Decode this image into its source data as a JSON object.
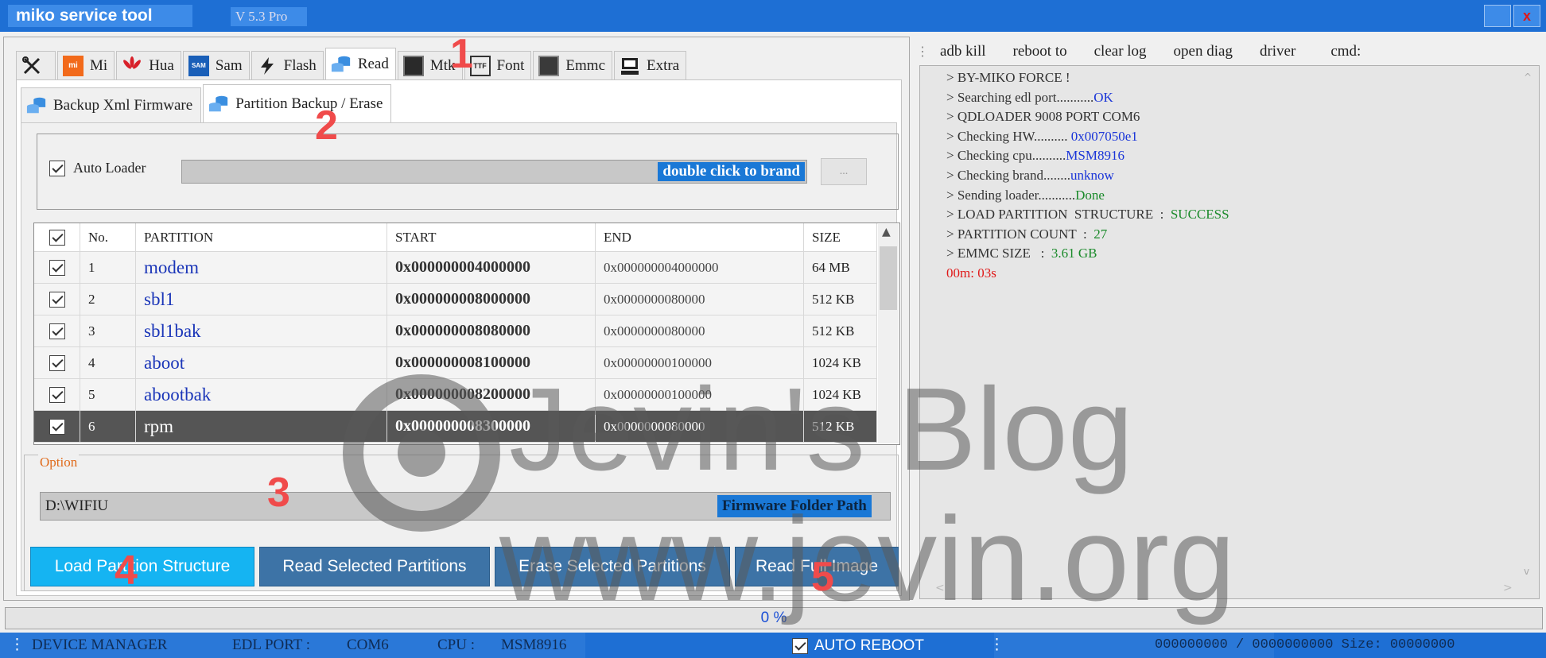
{
  "window": {
    "title": "miko service tool",
    "version": "V 5.3 Pro",
    "close_glyph": "x"
  },
  "main_tabs": [
    {
      "label": "",
      "icon": "tools-icon"
    },
    {
      "label": "Mi",
      "icon": "mi-logo-icon"
    },
    {
      "label": "Hua",
      "icon": "huawei-logo-icon"
    },
    {
      "label": "Sam",
      "icon": "samsung-logo-icon"
    },
    {
      "label": "Flash",
      "icon": "lightning-icon"
    },
    {
      "label": "Read",
      "icon": "database-icon"
    },
    {
      "label": "Mtk",
      "icon": "chip-icon"
    },
    {
      "label": "Font",
      "icon": "font-file-icon"
    },
    {
      "label": "Emmc",
      "icon": "emmc-chip-icon"
    },
    {
      "label": "Extra",
      "icon": "extra-icon"
    }
  ],
  "sub_tabs": [
    {
      "label": "Backup Xml Firmware",
      "icon": "database-icon"
    },
    {
      "label": "Partition Backup / Erase",
      "icon": "database-icon"
    }
  ],
  "auto_loader": {
    "label": "Auto Loader",
    "brand_text": "double click to brand",
    "browse_label": "...",
    "checked": true
  },
  "table": {
    "headers": [
      "No.",
      "PARTITION",
      "START",
      "END",
      "SIZE"
    ],
    "rows": [
      {
        "no": "1",
        "name": "modem",
        "start": "0x000000004000000",
        "end": "0x000000004000000",
        "size": "64 MB"
      },
      {
        "no": "2",
        "name": "sbl1",
        "start": "0x000000008000000",
        "end": "0x0000000080000",
        "size": "512 KB"
      },
      {
        "no": "3",
        "name": "sbl1bak",
        "start": "0x000000008080000",
        "end": "0x0000000080000",
        "size": "512 KB"
      },
      {
        "no": "4",
        "name": "aboot",
        "start": "0x000000008100000",
        "end": "0x00000000100000",
        "size": "1024 KB"
      },
      {
        "no": "5",
        "name": "abootbak",
        "start": "0x000000008200000",
        "end": "0x00000000100000",
        "size": "1024 KB"
      },
      {
        "no": "6",
        "name": "rpm",
        "start": "0x000000008300000",
        "end": "0x0000000080000",
        "size": "512 KB"
      }
    ],
    "selected_row": 6
  },
  "option": {
    "label": "Option",
    "path": "D:\\WIFIU",
    "path_button": "Firmware Folder Path"
  },
  "buttons": {
    "load": "Load Partition Structure",
    "read": "Read Selected Partitions",
    "erase": "Erase Selected Partitions",
    "read_full": "Read Full Image"
  },
  "commands": [
    "adb kill",
    "reboot to",
    "clear log",
    "open diag",
    "driver",
    "cmd:"
  ],
  "log": [
    {
      "text": "> BY-MIKO FORCE !",
      "value": "",
      "color": "#333333"
    },
    {
      "text": "> Searching edl port...........",
      "value": "OK",
      "color": "#1a35d8"
    },
    {
      "text": "> QDLOADER 9008 PORT COM6",
      "value": "",
      "color": "#333333"
    },
    {
      "text": "> Checking HW..........",
      "value": " 0x007050e1",
      "color": "#1a35d8"
    },
    {
      "text": "> Checking cpu..........",
      "value": "MSM8916",
      "color": "#1a35d8"
    },
    {
      "text": "> Checking brand........",
      "value": "unknow",
      "color": "#1a35d8"
    },
    {
      "text": "> Sending loader...........",
      "value": "Done",
      "color": "#1a8a2a"
    },
    {
      "text": "> LOAD PARTITION  STRUCTURE  :  ",
      "value": "SUCCESS",
      "color": "#1a8a2a"
    },
    {
      "text": "> PARTITION COUNT  :  ",
      "value": "27",
      "color": "#1a8a2a"
    },
    {
      "text": "> EMMC SIZE   :  ",
      "value": "3.61 GB",
      "color": "#1a8a2a"
    },
    {
      "text": "",
      "value": "00m: 03s",
      "color": "#e01818"
    }
  ],
  "progress": {
    "text": "0  %",
    "value": 0
  },
  "status_bar": {
    "device_manager": "DEVICE MANAGER",
    "edl_port_label": "EDL PORT :",
    "edl_port": "COM6",
    "cpu_label": "CPU :",
    "cpu": "MSM8916",
    "auto_reboot": "AUTO REBOOT",
    "counter": "000000000 / 0000000000 Size: 00000000"
  },
  "watermark": {
    "line1": "Jevin's Blog",
    "line2": "www.jevin.org"
  },
  "annotations": [
    "1",
    "2",
    "3",
    "4",
    "5"
  ]
}
